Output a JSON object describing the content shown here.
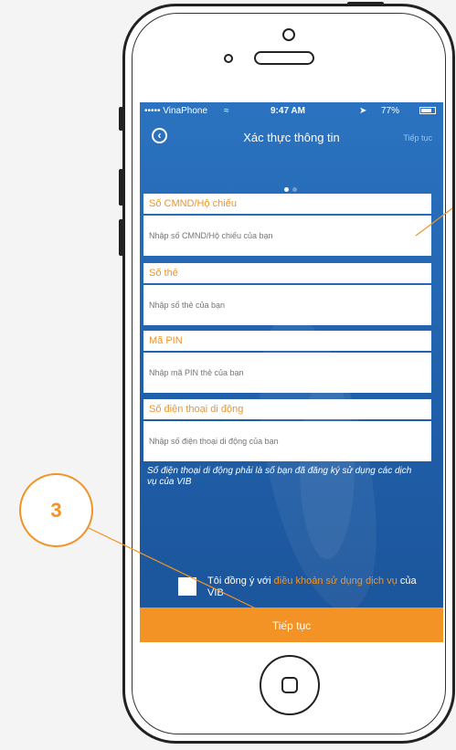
{
  "colors": {
    "accent": "#f39325",
    "screen_blue": "#2b73c0"
  },
  "status_bar": {
    "carrier": "••••• VinaPhone",
    "wifi_icon": "wifi-icon",
    "time": "9:47 AM",
    "battery": "77%"
  },
  "nav": {
    "back_icon": "chevron-left-icon",
    "title": "Xác thực thông tin",
    "next": "Tiếp tục"
  },
  "pager": {
    "pages": 2,
    "active": 1
  },
  "form": {
    "fields": [
      {
        "label": "Số CMND/Hộ chiếu",
        "placeholder": "Nhập số CMND/Hộ chiếu của bạn"
      },
      {
        "label": "Số thẻ",
        "placeholder": "Nhập số thẻ của bạn"
      },
      {
        "label": "Mã PIN",
        "placeholder": "Nhập mã PIN thẻ của bạn"
      },
      {
        "label": "Số điện thoại di động",
        "placeholder": "Nhập số điện thoại di động của bạn"
      }
    ],
    "note": "Số điện thoại di động phải là số bạn đã đăng ký sử dụng các dịch vụ của VIB"
  },
  "agreement": {
    "prefix": "Tôi đồng ý với ",
    "link": "điều khoản sử dụng dịch vụ",
    "suffix": " của VIB"
  },
  "submit_label": "Tiếp tục",
  "callout": {
    "number": "3"
  }
}
